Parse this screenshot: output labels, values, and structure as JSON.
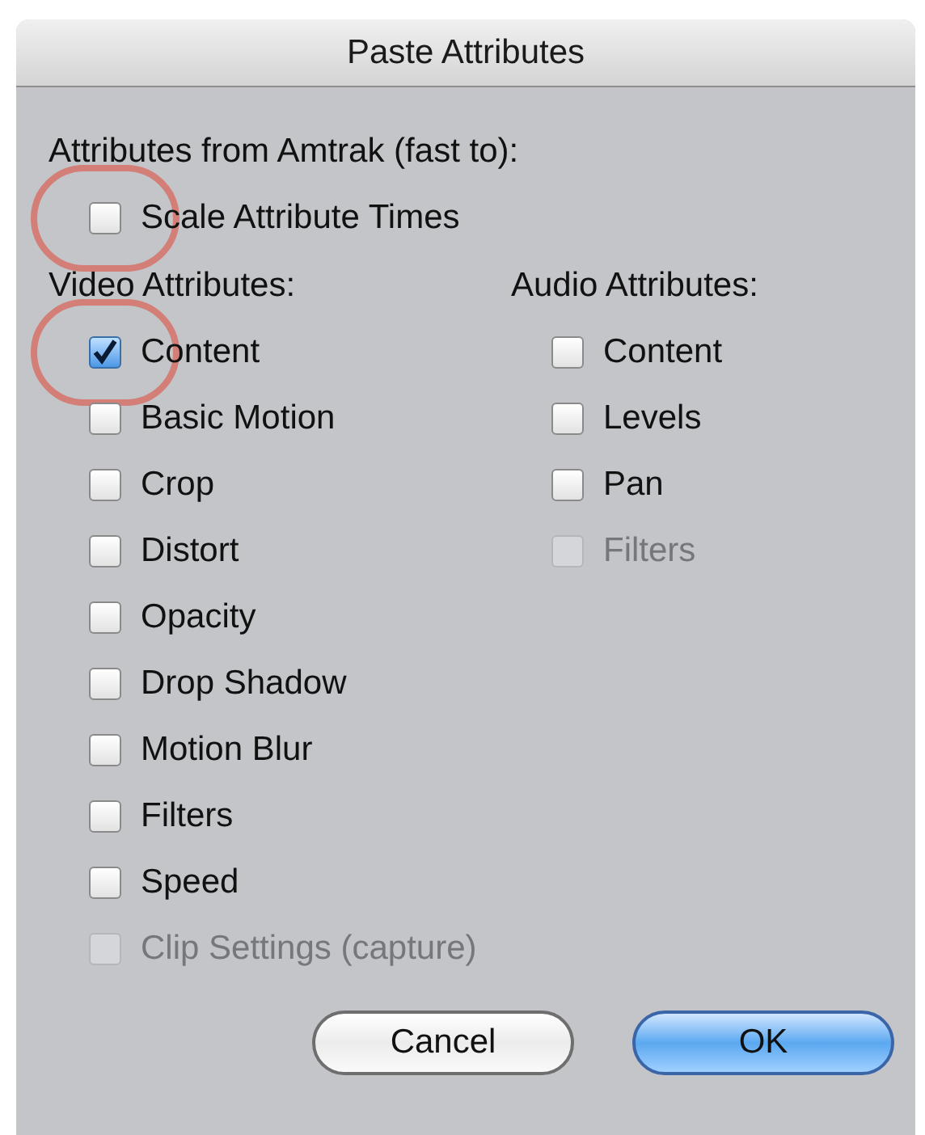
{
  "window": {
    "title": "Paste Attributes"
  },
  "source_label": "Attributes from Amtrak (fast to):",
  "scale_option": {
    "label": "Scale Attribute Times",
    "checked": false,
    "disabled": false,
    "highlighted": true
  },
  "video": {
    "heading": "Video Attributes:",
    "items": [
      {
        "label": "Content",
        "checked": true,
        "disabled": false,
        "highlighted": true
      },
      {
        "label": "Basic Motion",
        "checked": false,
        "disabled": false,
        "highlighted": false
      },
      {
        "label": "Crop",
        "checked": false,
        "disabled": false,
        "highlighted": false
      },
      {
        "label": "Distort",
        "checked": false,
        "disabled": false,
        "highlighted": false
      },
      {
        "label": "Opacity",
        "checked": false,
        "disabled": false,
        "highlighted": false
      },
      {
        "label": "Drop Shadow",
        "checked": false,
        "disabled": false,
        "highlighted": false
      },
      {
        "label": "Motion Blur",
        "checked": false,
        "disabled": false,
        "highlighted": false
      },
      {
        "label": "Filters",
        "checked": false,
        "disabled": false,
        "highlighted": false
      },
      {
        "label": "Speed",
        "checked": false,
        "disabled": false,
        "highlighted": false
      },
      {
        "label": "Clip Settings (capture)",
        "checked": false,
        "disabled": true,
        "highlighted": false
      }
    ]
  },
  "audio": {
    "heading": "Audio Attributes:",
    "items": [
      {
        "label": "Content",
        "checked": false,
        "disabled": false,
        "highlighted": false
      },
      {
        "label": "Levels",
        "checked": false,
        "disabled": false,
        "highlighted": false
      },
      {
        "label": "Pan",
        "checked": false,
        "disabled": false,
        "highlighted": false
      },
      {
        "label": "Filters",
        "checked": false,
        "disabled": true,
        "highlighted": false
      }
    ]
  },
  "buttons": [
    {
      "label": "Cancel",
      "default": false
    },
    {
      "label": "OK",
      "default": true
    }
  ]
}
